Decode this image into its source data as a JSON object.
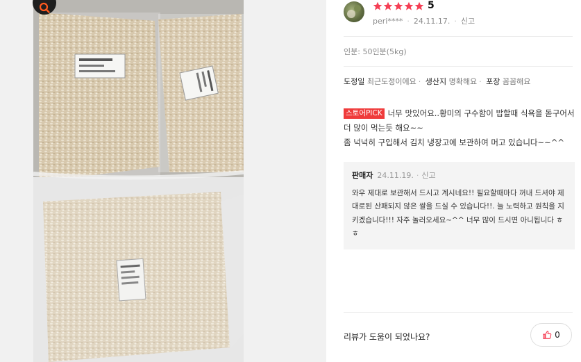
{
  "review": {
    "user": "peri****",
    "date": "24.11.17.",
    "report_label": "신고",
    "rating": "5",
    "stars_filled": 5,
    "serving": "인분: 50인분(5kg)",
    "attributes": [
      {
        "key": "도정일",
        "value": "최근도정이에요"
      },
      {
        "key": "생산지",
        "value": "명확해요"
      },
      {
        "key": "포장",
        "value": "꼼꼼해요"
      }
    ],
    "badge": "스토어PICK",
    "text_line1": "너무 맛있어요..황미의 구수함이 밥할때 식욕을 돋구어서 더 많이 먹는듯 해요~~",
    "text_line2": "좀 넉넉히 구입해서 김치 냉장고에 보관하여 머고 있습니다~~^^"
  },
  "reply": {
    "author": "판매자",
    "date": "24.11.19.",
    "report_label": "신고",
    "text": "와우 제대로 보관해서 드시고 계시네요!! 필요할때마다 꺼내 드셔야 제대로된 산패되지 않은 쌀을 드실 수 있습니다!!. 늘 노력하고 원칙을 지키겠습니다!!! 자주 놀러오세요~^^ 너무 많이 드시면 아니됩니다 ㅎㅎ"
  },
  "footer": {
    "helpful_question": "리뷰가 도움이 되었나요?",
    "like_count": "0"
  },
  "colors": {
    "star": "#f53e54",
    "badge_bg": "#ef3b3b",
    "zoom_accent": "#ff5a1f"
  },
  "icons": [
    "zoom-icon",
    "star-icon",
    "thumbs-up-icon"
  ]
}
